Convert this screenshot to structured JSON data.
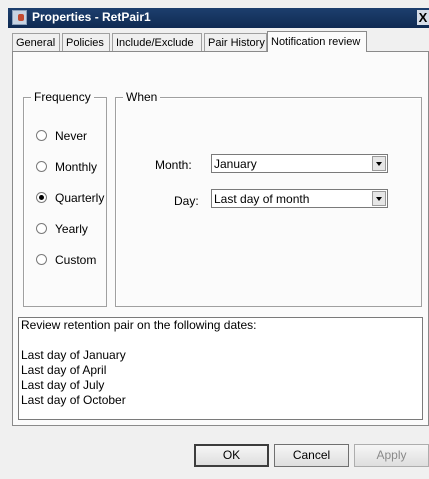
{
  "window": {
    "title": "Properties - RetPair1",
    "close_label": "X"
  },
  "tabs": [
    {
      "label": "General"
    },
    {
      "label": "Policies"
    },
    {
      "label": "Include/Exclude"
    },
    {
      "label": "Pair History"
    },
    {
      "label": "Notification review",
      "active": true
    }
  ],
  "frequency": {
    "group_label": "Frequency",
    "options": [
      {
        "label": "Never",
        "checked": false
      },
      {
        "label": "Monthly",
        "checked": false
      },
      {
        "label": "Quarterly",
        "checked": true
      },
      {
        "label": "Yearly",
        "checked": false
      },
      {
        "label": "Custom",
        "checked": false
      }
    ]
  },
  "when": {
    "group_label": "When",
    "month_label": "Month:",
    "month_value": "January",
    "day_label": "Day:",
    "day_value": "Last day of month"
  },
  "summary": {
    "heading": "Review retention pair on the following dates:",
    "blank": "",
    "dates": [
      "Last day of January",
      "Last day of April",
      "Last day of July",
      "Last day of October"
    ]
  },
  "buttons": {
    "ok": "OK",
    "cancel": "Cancel",
    "apply": "Apply"
  }
}
